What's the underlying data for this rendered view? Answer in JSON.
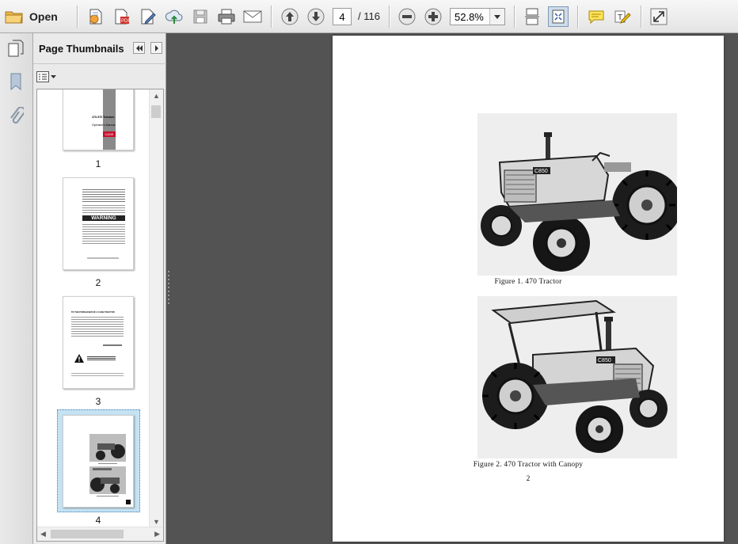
{
  "toolbar": {
    "open_label": "Open",
    "current_page": "4",
    "total_pages": "/ 116",
    "zoom": "52.8%",
    "icons": [
      "folder-icon",
      "create-pdf-icon",
      "combine-icon",
      "edit-icon",
      "cloud-upload-icon",
      "save-icon",
      "print-icon",
      "email-icon",
      "page-up-icon",
      "page-down-icon",
      "zoom-out-icon",
      "zoom-in-icon",
      "scroll-mode-icon",
      "fit-page-icon",
      "comment-icon",
      "highlight-icon",
      "fullscreen-icon"
    ]
  },
  "panel": {
    "title": "Page Thumbnails",
    "thumbnails": [
      {
        "number": "1",
        "title_text": "470-570 Tractors",
        "sub_text": "Operator's Manual",
        "brand": "CASE"
      },
      {
        "number": "2",
        "warning_label": "WARNING"
      },
      {
        "number": "3",
        "heading": "TO THE PURCHASER OF A CASE TRACTOR"
      },
      {
        "number": "4",
        "selected": true
      }
    ]
  },
  "document": {
    "figure1_caption": "Figure 1. 470 Tractor",
    "figure2_caption": "Figure 2. 470 Tractor with Canopy",
    "page_number": "2",
    "hood_label": "C850"
  },
  "colors": {
    "toolbar_bg": "#ececec",
    "viewer_bg": "#535353",
    "selection": "#c7e3f3",
    "brand_red": "#c8102e"
  }
}
